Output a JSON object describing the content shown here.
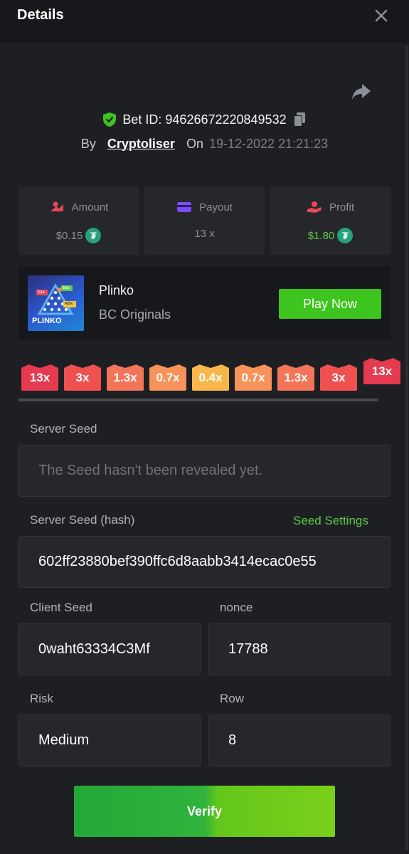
{
  "header": {
    "title": "Details"
  },
  "bet": {
    "id_text": "Bet ID: 94626672220849532",
    "by_label": "By",
    "user": "Cryptoliser",
    "on_label": "On",
    "datetime": "19-12-2022 21:21:23"
  },
  "stats": {
    "amount": {
      "label": "Amount",
      "value": "$0.15",
      "currency_icon": "tether-icon"
    },
    "payout": {
      "label": "Payout",
      "value": "13 x"
    },
    "profit": {
      "label": "Profit",
      "value": "$1.80",
      "currency_icon": "tether-icon"
    }
  },
  "game": {
    "name": "Plinko",
    "provider": "BC Originals",
    "play_label": "Play Now",
    "thumb_text": "PLINKO",
    "thumb_tags": [
      "2.1x",
      "0.5x",
      "420x"
    ]
  },
  "multipliers": [
    {
      "label": "13x",
      "color": "#e63a50"
    },
    {
      "label": "3x",
      "color": "#ef5151"
    },
    {
      "label": "1.3x",
      "color": "#f2755a"
    },
    {
      "label": "0.7x",
      "color": "#f6925a"
    },
    {
      "label": "0.4x",
      "color": "#f9b74b"
    },
    {
      "label": "0.7x",
      "color": "#f6925a"
    },
    {
      "label": "1.3x",
      "color": "#f2755a"
    },
    {
      "label": "3x",
      "color": "#ef5151"
    },
    {
      "label": "13x",
      "color": "#e63a50"
    }
  ],
  "form": {
    "server_seed_label": "Server Seed",
    "server_seed_value": "The Seed hasn't been revealed yet.",
    "server_hash_label": "Server Seed (hash)",
    "seed_settings": "Seed Settings",
    "server_hash_value": "602ff23880bef390ffc6d8aabb3414ecac0e55",
    "client_seed_label": "Client Seed",
    "client_seed_value": "0waht63334C3Mf",
    "nonce_label": "nonce",
    "nonce_value": "17788",
    "risk_label": "Risk",
    "risk_value": "Medium",
    "row_label": "Row",
    "row_value": "8"
  },
  "verify_label": "Verify",
  "colors": {
    "accent_green": "#3dc41e",
    "background": "#1e1f22",
    "card": "#26272b",
    "shield_green": "#3dc41e",
    "amount_icon": "#e8485a",
    "payout_icon": "#7b4dff",
    "profit_icon": "#e8485a"
  }
}
